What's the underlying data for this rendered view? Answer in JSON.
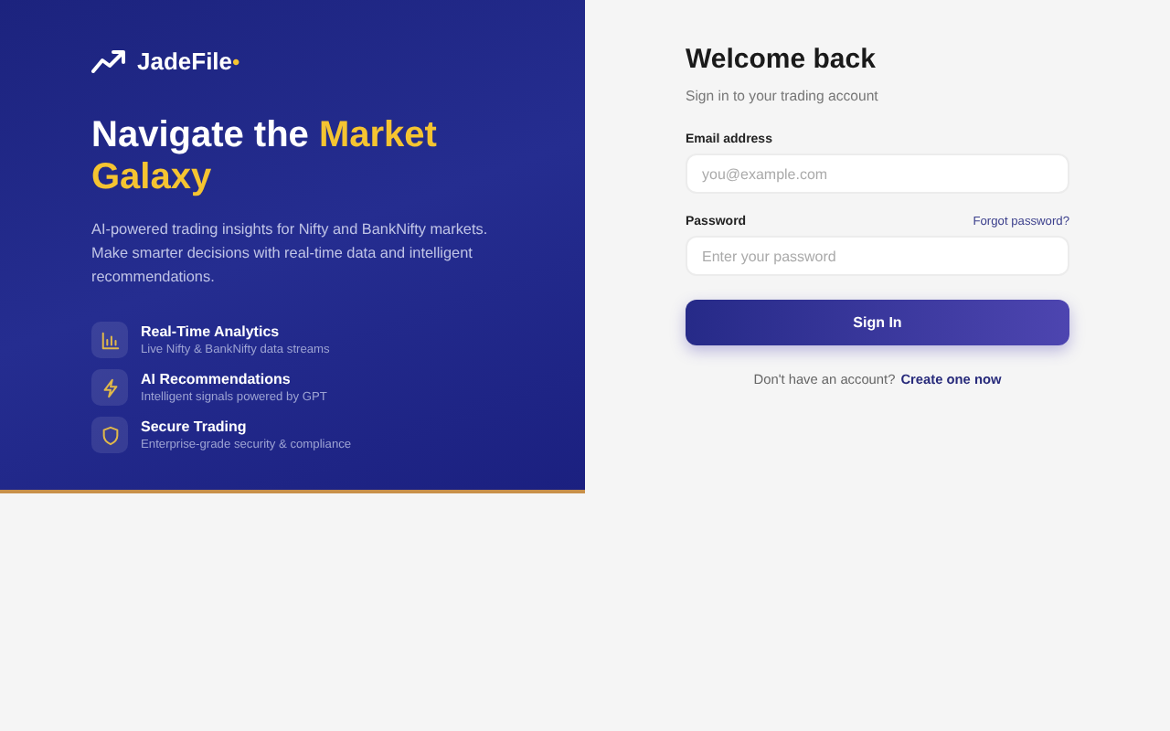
{
  "brand": {
    "name": "JadeFile",
    "dot": "•"
  },
  "hero": {
    "title_start": "Navigate the",
    "title_highlight": "Market Galaxy",
    "description": "AI-powered trading insights for Nifty and BankNifty markets. Make smarter decisions with real-time data and intelligent recommendations."
  },
  "features": [
    {
      "kind": "chart",
      "title": "Real-Time Analytics",
      "subtitle": "Live Nifty & BankNifty data streams"
    },
    {
      "kind": "bolt",
      "title": "AI Recommendations",
      "subtitle": "Intelligent signals powered by GPT"
    },
    {
      "kind": "shield",
      "title": "Secure Trading",
      "subtitle": "Enterprise-grade security & compliance"
    }
  ],
  "form": {
    "title": "Welcome back",
    "subtitle": "Sign in to your trading account",
    "email_label": "Email address",
    "email_placeholder": "you@example.com",
    "password_label": "Password",
    "forgot_link": "Forgot password?",
    "password_placeholder": "Enter your password",
    "submit": "Sign In",
    "footer_text": "Don't have an account?",
    "footer_link": "Create one now"
  }
}
